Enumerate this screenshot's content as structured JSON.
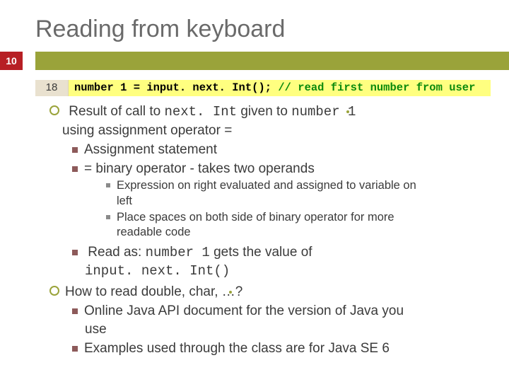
{
  "title": "Reading from keyboard",
  "slide_number": "10",
  "code": {
    "line_no": "18",
    "black": "number 1 = input. next. Int(); ",
    "green": "// read first number from user"
  },
  "b1": {
    "pre": "Result of call to ",
    "mono1": "next. Int",
    "mid": " given to ",
    "mono2": "number 1",
    "cont": "using assignment operator ="
  },
  "b2a": "Assignment statement",
  "b2b": "= binary operator - takes two operands",
  "b3a": "Expression on right evaluated and assigned to variable on",
  "b3a_cont": "left",
  "b3b": "Place spaces on both side of binary operator for more",
  "b3b_cont": "readable code",
  "b4": {
    "pre": "Read as:  ",
    "mono1": "number 1",
    "mid": " gets the value of",
    "mono2": "input. next. Int()"
  },
  "b5": "How to read double, char, …?",
  "b6a": "Online Java API document for the version of Java you",
  "b6a_cont": "use",
  "b6b": "Examples used through the class are for Java SE 6"
}
